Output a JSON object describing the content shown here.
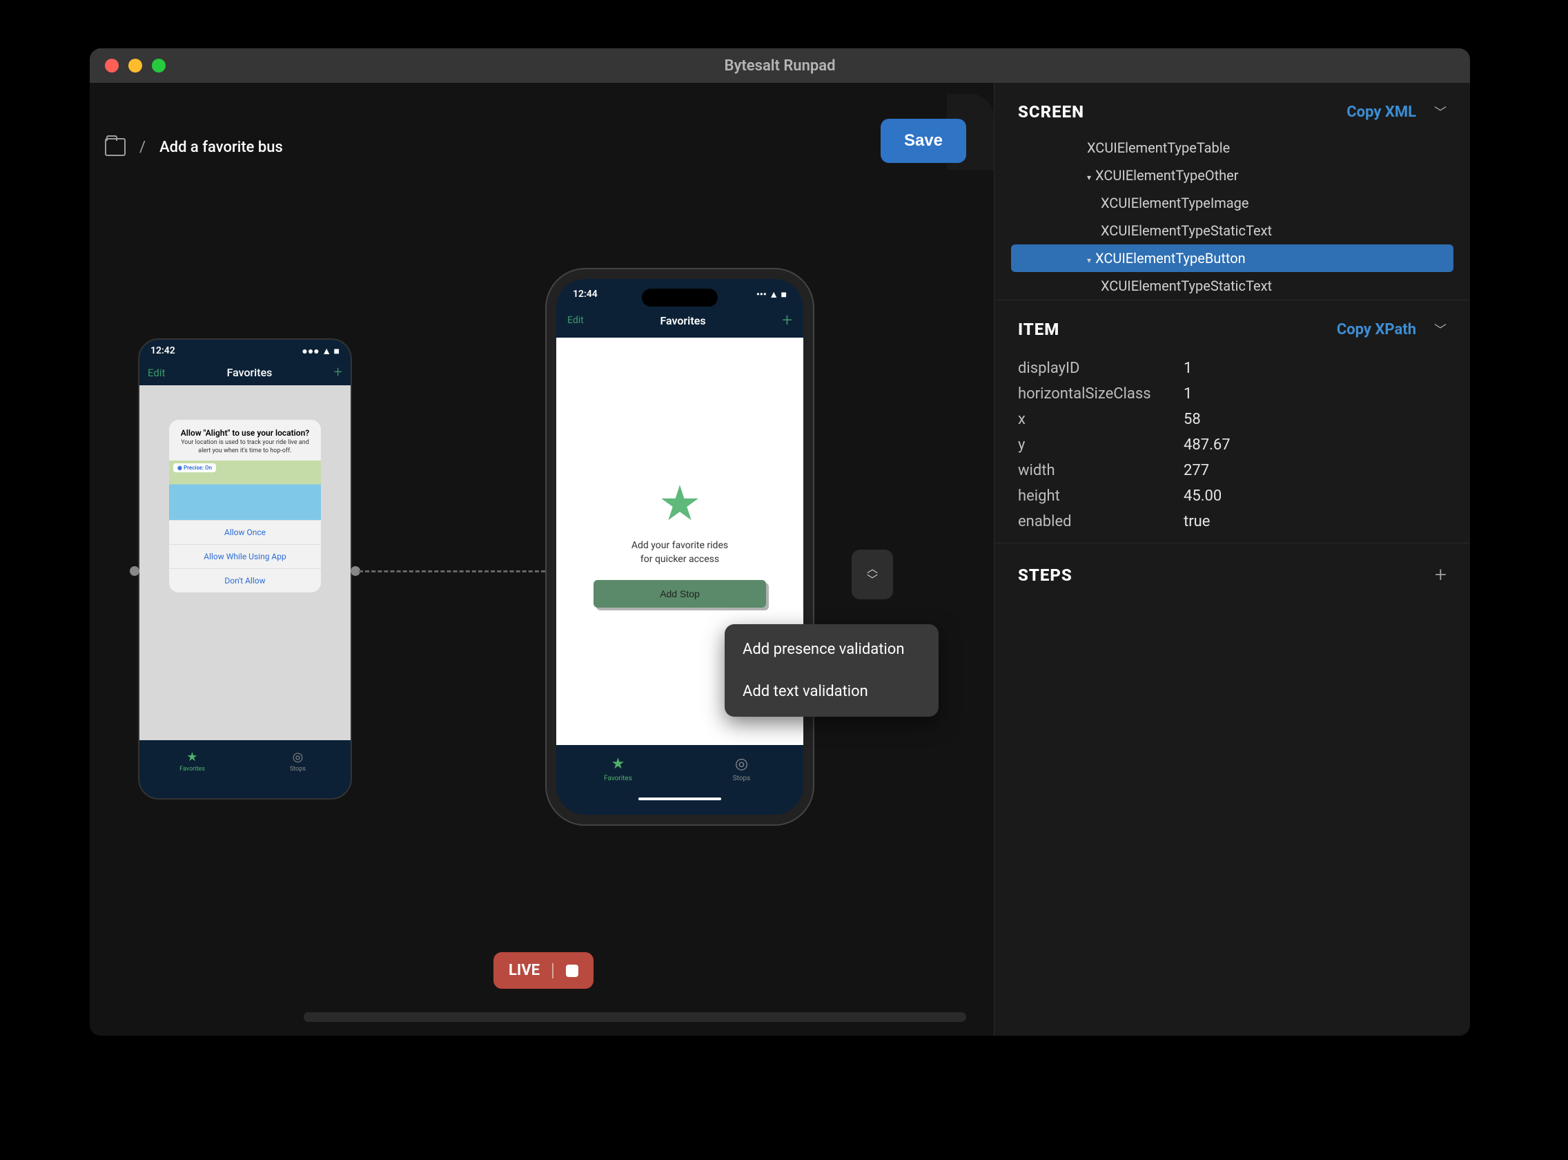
{
  "window": {
    "title": "Bytesalt Runpad"
  },
  "header": {
    "breadcrumb_title": "Add a favorite bus",
    "save_label": "Save"
  },
  "phone_small": {
    "time": "12:42",
    "edit": "Edit",
    "title": "Favorites",
    "alert": {
      "title": "Allow \"Alight\" to use your location?",
      "desc": "Your location is used to track your ride live and alert you when it's time to hop-off.",
      "precise": "◉ Precise: On",
      "options": [
        "Allow Once",
        "Allow While Using App",
        "Don't Allow"
      ]
    },
    "tabs": {
      "favorites": "Favorites",
      "stops": "Stops"
    }
  },
  "phone_large": {
    "time": "12:44",
    "edit": "Edit",
    "title": "Favorites",
    "empty_line1": "Add your favorite rides",
    "empty_line2": "for quicker access",
    "add_stop": "Add Stop",
    "tabs": {
      "favorites": "Favorites",
      "stops": "Stops"
    }
  },
  "context_menu": {
    "items": [
      "Add presence validation",
      "Add text validation"
    ]
  },
  "live": {
    "label": "LIVE"
  },
  "sidebar": {
    "screen": {
      "title": "SCREEN",
      "action": "Copy XML",
      "tree": [
        {
          "label": "XCUIElementTypeTable",
          "indent": "l2"
        },
        {
          "label": "XCUIElementTypeOther",
          "indent": "l2",
          "caret": "▾"
        },
        {
          "label": "XCUIElementTypeImage",
          "indent": "l3"
        },
        {
          "label": "XCUIElementTypeStaticText",
          "indent": "l3"
        },
        {
          "label": "XCUIElementTypeButton",
          "indent": "l2",
          "caret": "▾",
          "selected": true
        },
        {
          "label": "XCUIElementTypeStaticText",
          "indent": "l3"
        }
      ]
    },
    "item": {
      "title": "ITEM",
      "action": "Copy XPath",
      "props": [
        {
          "k": "displayID",
          "v": "1"
        },
        {
          "k": "horizontalSizeClass",
          "v": "1"
        },
        {
          "k": "x",
          "v": "58"
        },
        {
          "k": "y",
          "v": "487.67"
        },
        {
          "k": "width",
          "v": "277"
        },
        {
          "k": "height",
          "v": "45.00"
        },
        {
          "k": "enabled",
          "v": "true"
        }
      ]
    },
    "steps": {
      "title": "STEPS"
    }
  }
}
